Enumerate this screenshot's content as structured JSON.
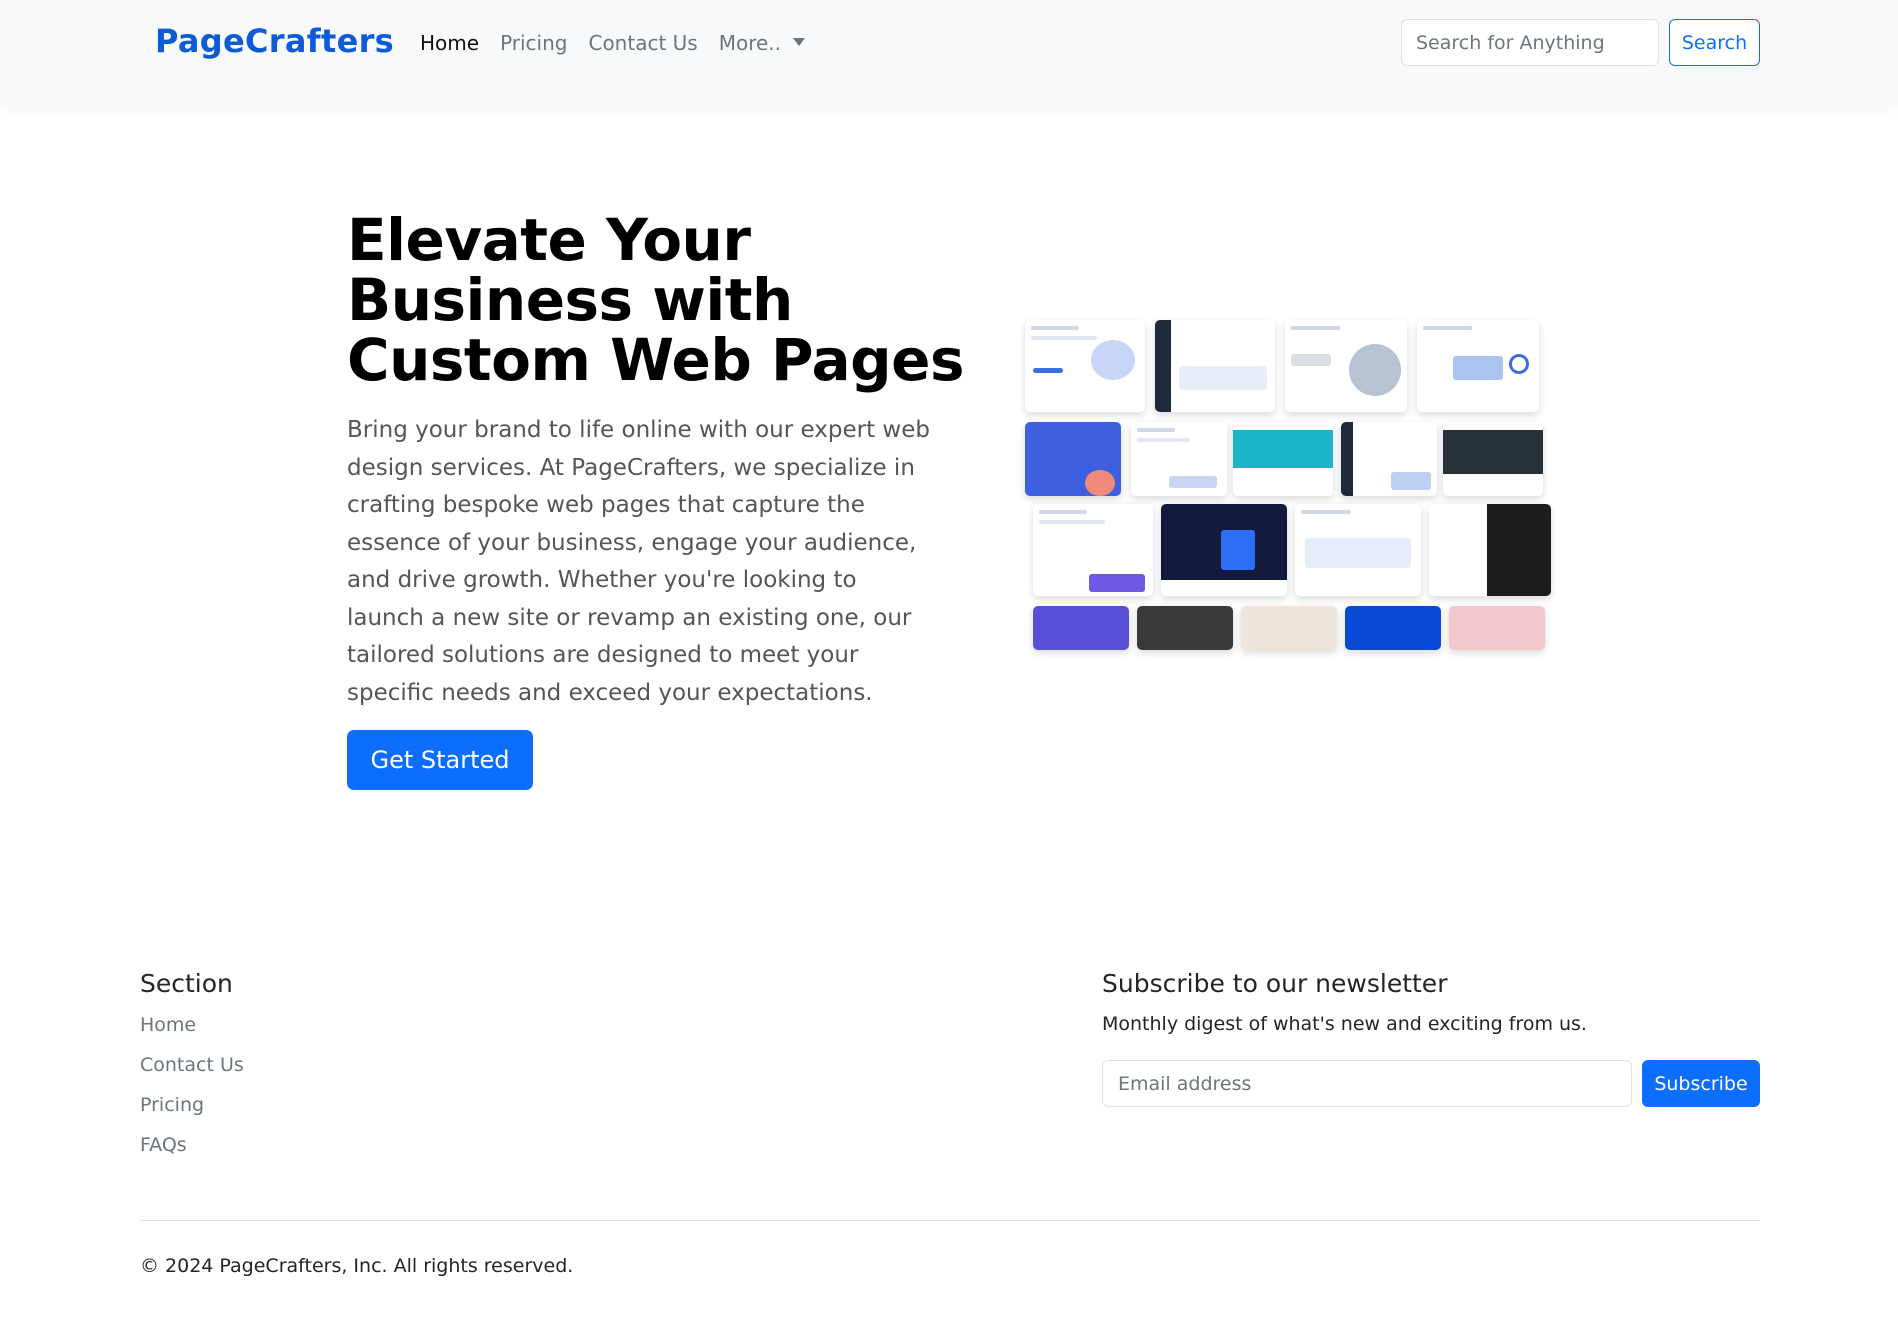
{
  "navbar": {
    "brand": "PageCrafters",
    "links": [
      "Home",
      "Pricing",
      "Contact Us",
      "More.."
    ],
    "search_placeholder": "Search for Anything",
    "search_button": "Search"
  },
  "hero": {
    "title": "Elevate Your Business with Custom Web Pages",
    "text": "Bring your brand to life online with our expert web design services. At PageCrafters, we specialize in crafting bespoke web pages that capture the essence of your business, engage your audience, and drive growth. Whether you're looking to launch a new site or revamp an existing one, our tailored solutions are designed to meet your specific needs and exceed your expectations.",
    "cta": "Get Started"
  },
  "footer": {
    "section_heading": "Section",
    "links": [
      "Home",
      "Contact Us",
      "Pricing",
      "FAQs"
    ],
    "newsletter_heading": "Subscribe to our newsletter",
    "newsletter_sub": "Monthly digest of what's new and exciting from us.",
    "email_placeholder": "Email address",
    "subscribe_button": "Subscribe",
    "copyright": "© 2024 PageCrafters, Inc. All rights reserved."
  },
  "colors": {
    "primary": "#0d6efd",
    "brand": "#0d5bd6",
    "navbar_bg": "#f8f9fa",
    "muted_text": "#6c757d"
  }
}
